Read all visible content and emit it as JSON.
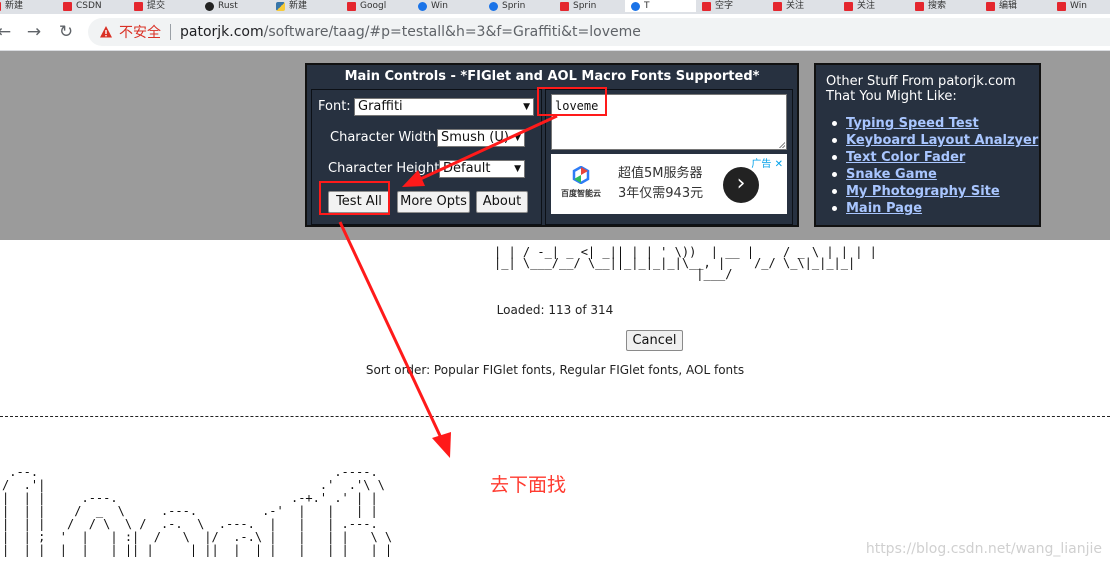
{
  "browser": {
    "tabs": [
      {
        "label": "新建",
        "icon": "red-square-icon"
      },
      {
        "label": "CSDN",
        "icon": "red-square-icon"
      },
      {
        "label": "提交",
        "icon": "red-square-icon"
      },
      {
        "label": "Rust",
        "icon": "github-icon"
      },
      {
        "label": "新建",
        "icon": "python-icon"
      },
      {
        "label": "Googl",
        "icon": "red-square-icon"
      },
      {
        "label": "Win",
        "icon": "blue-globe-icon"
      },
      {
        "label": "Sprin",
        "icon": "blue-globe-icon"
      },
      {
        "label": "Sprin",
        "icon": "red-square-icon"
      },
      {
        "label": "T",
        "icon": "blue-globe-icon"
      },
      {
        "label": "空字",
        "icon": "red-square-icon"
      },
      {
        "label": "关注",
        "icon": "red-square-icon"
      },
      {
        "label": "关注",
        "icon": "red-square-icon"
      },
      {
        "label": "搜索",
        "icon": "red-square-icon"
      },
      {
        "label": "编辑",
        "icon": "red-square-icon"
      },
      {
        "label": "Win",
        "icon": "red-square-icon"
      }
    ],
    "security_label": "不安全",
    "url_host": "patorjk.com",
    "url_path": "/software/taag/#p=testall&h=3&f=Graffiti&t=loveme"
  },
  "main_controls": {
    "title": "Main Controls - *FIGlet and AOL Macro Fonts Supported*",
    "font_label": "Font:",
    "font_value": "Graffiti",
    "width_label": "Character Width:",
    "width_value": "Smush (U)",
    "height_label": "Character Height:",
    "height_value": "Default",
    "test_all_label": "Test All",
    "more_opts_label": "More Opts",
    "about_label": "About",
    "text_input_value": "loveme"
  },
  "ad": {
    "tag": "广告",
    "brand": "百度智能云",
    "line1": "超值5M服务器",
    "line2": "3年仅需943元",
    "arrow": "›"
  },
  "other_stuff": {
    "title_line1": "Other Stuff From patorjk.com",
    "title_line2": "That You Might Like:",
    "links": [
      "Typing Speed Test",
      "Keyboard Layout Analzyer",
      "Text Color Fader",
      "Snake Game",
      "My Photography Site",
      "Main Page"
    ]
  },
  "results": {
    "ascii_top": "| | / -_| _ <| _|| | | ' \\))  | __ |    / _ \\ | | | |\n|_| \\___/__/ \\__||_|_|_|_|\\__, |    /_/ \\_\\|_|_|_|\n                            |___/",
    "loaded": "Loaded: 113 of 314",
    "cancel_label": "Cancel",
    "sort_order": "Sort order: Popular FIGlet fonts, Regular FIGlet fonts, AOL fonts",
    "ascii_bottom": " .--.                                         .----.\n/  .'|                                      .'  .'\\ \\\n|  | |     .---.                        .-+.' .' | |\n|  | |    /  _  \\     .---.         .-'  |   |   | |\n|  | |   /  / \\  \\ /  .-.  \\  .---.  |   |   | .---.\n|  | ;  '  |   | :|  /   \\  |/  .-.\\ |   |   | |   \\ \\\n|  | |  |  |   | || |     | ||  |  | |   |   | |   | |"
  },
  "annotation": {
    "note": "去下面找"
  },
  "watermark": "https://blog.csdn.net/wang_lianjie"
}
